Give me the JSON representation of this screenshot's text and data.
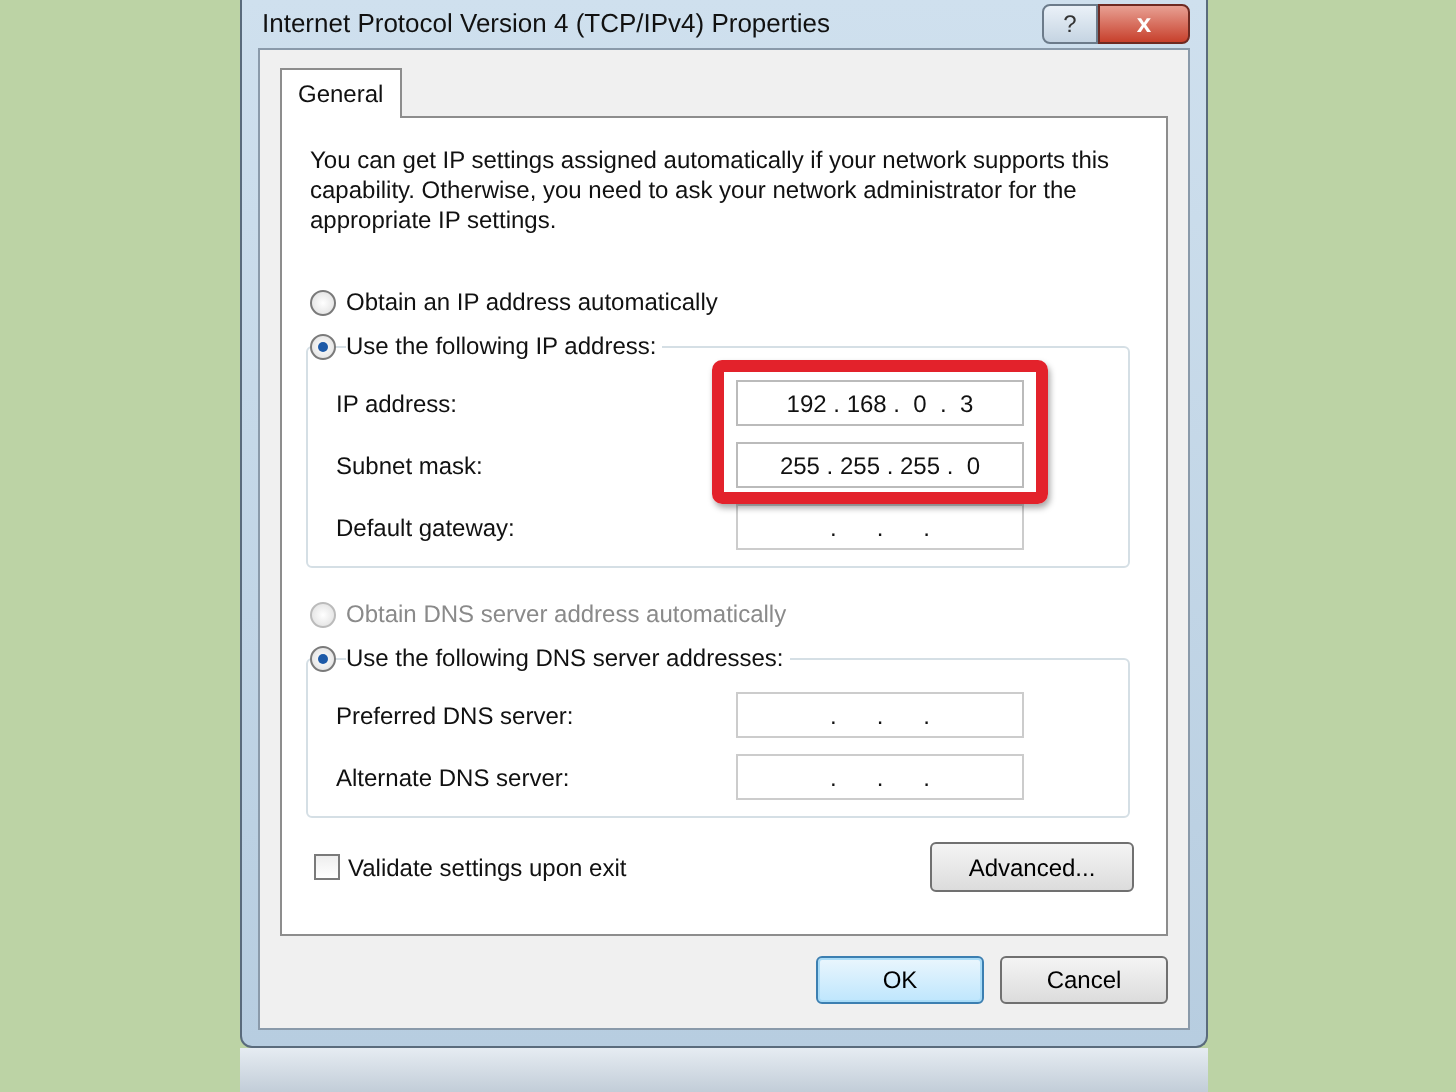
{
  "window": {
    "title": "Internet Protocol Version 4 (TCP/IPv4) Properties",
    "help_button": "?",
    "close_button": "x"
  },
  "tabs": [
    {
      "label": "General",
      "selected": true
    }
  ],
  "intro": "You can get IP settings assigned automatically if your network supports this capability. Otherwise, you need to ask your network administrator for the appropriate IP settings.",
  "ip_options": [
    {
      "label": "Obtain an IP address automatically",
      "selected": false,
      "disabled": false
    },
    {
      "label": "Use the following IP address:",
      "selected": true,
      "disabled": false
    }
  ],
  "ip_fields": [
    {
      "label": "IP address:",
      "value": "192 . 168 .  0  .  3",
      "highlighted": true
    },
    {
      "label": "Subnet mask:",
      "value": "255 . 255 . 255 .  0",
      "highlighted": true
    },
    {
      "label": "Default gateway:",
      "value": ".      .      .",
      "highlighted": false
    }
  ],
  "dns_options": [
    {
      "label": "Obtain DNS server address automatically",
      "selected": false,
      "disabled": true
    },
    {
      "label": "Use the following DNS server addresses:",
      "selected": true,
      "disabled": false
    }
  ],
  "dns_fields": [
    {
      "label": "Preferred DNS server:",
      "value": ".      .      .",
      "highlighted": false
    },
    {
      "label": "Alternate DNS server:",
      "value": ".      .      .",
      "highlighted": false
    }
  ],
  "validate": {
    "label": "Validate settings upon exit",
    "checked": false
  },
  "advanced_button": "Advanced...",
  "buttons": [
    {
      "label": "OK",
      "default": true
    },
    {
      "label": "Cancel",
      "default": false
    }
  ]
}
